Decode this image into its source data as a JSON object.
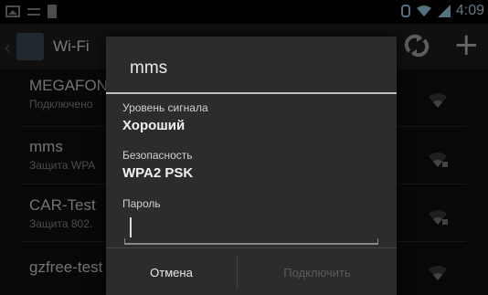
{
  "status_bar": {
    "time": "4:09",
    "left_icons": [
      "image-icon",
      "equals-icon",
      "file-icon"
    ],
    "right_icons": [
      "bluetooth-icon",
      "wifi-icon",
      "signal-icon"
    ]
  },
  "action_bar": {
    "title": "Wi-Fi",
    "icons": [
      "back-icon",
      "wifi-settings-icon",
      "refresh-icon",
      "add-icon"
    ],
    "add_glyph": "+"
  },
  "networks": [
    {
      "name": "MEGAFON",
      "subtitle": "Подключено"
    },
    {
      "name": "mms",
      "subtitle": "Защита WPA"
    },
    {
      "name": "CAR-Test",
      "subtitle": "Защита 802."
    },
    {
      "name": "gzfree-test",
      "subtitle": ""
    }
  ],
  "dialog": {
    "title": "mms",
    "signal_label": "Уровень сигнала",
    "signal_value": "Хороший",
    "security_label": "Безопасность",
    "security_value": "WPA2 PSK",
    "password_label": "Пароль",
    "password_value": "",
    "cancel_label": "Отмена",
    "connect_label": "Подключить"
  },
  "colors": {
    "accent_status": "#9ad0e8",
    "dialog_bg": "#2c2c2c",
    "disabled_text": "#5a5a5a"
  }
}
